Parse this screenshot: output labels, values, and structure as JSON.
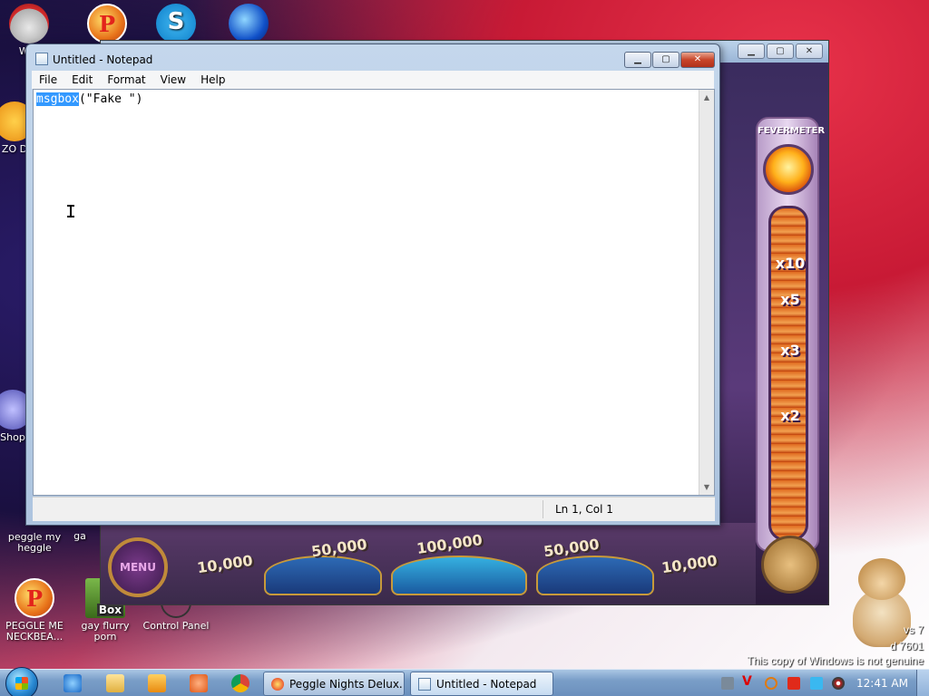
{
  "desktop": {
    "icons": [
      {
        "label": "WIN",
        "icon": "wii-icon"
      },
      {
        "label": "ZO D",
        "icon": "zoom-icon"
      },
      {
        "label": "Shop",
        "icon": "shop-icon"
      },
      {
        "label": "peggle my heggle",
        "icon": "peggle-icon"
      },
      {
        "label": "ga",
        "icon": "game-icon"
      },
      {
        "label": "PEGGLE ME NECKBEA...",
        "icon": "peggle-icon"
      },
      {
        "label": "gay flurry porn",
        "icon": "box-icon"
      },
      {
        "label": "Control Panel",
        "icon": "control-panel-icon"
      }
    ],
    "box_label": "Box",
    "watermark": {
      "line1": "vs 7",
      "line2": "d 7601",
      "line3": "This copy of Windows is not genuine"
    }
  },
  "peggle": {
    "fevermeter_label": "FEVERMETER",
    "multipliers": [
      "x10",
      "x5",
      "x3",
      "x2"
    ],
    "scores": [
      "10,000",
      "50,000",
      "100,000",
      "50,000",
      "10,000"
    ],
    "menu_label": "MENU",
    "controls": {
      "minimize": "▁",
      "maximize": "▢",
      "close": "✕"
    }
  },
  "notepad": {
    "title": "Untitled - Notepad",
    "controls": {
      "minimize": "▁",
      "maximize": "▢",
      "close": "✕"
    },
    "menu": [
      "File",
      "Edit",
      "Format",
      "View",
      "Help"
    ],
    "content_selected": "msgbox",
    "content_rest": "(\"Fake \")",
    "status": "Ln 1, Col 1"
  },
  "taskbar": {
    "quick_launch": [
      "internet-explorer-icon",
      "folder-icon",
      "media-player-icon",
      "paint-icon",
      "chrome-icon"
    ],
    "buttons": [
      {
        "label": "Peggle Nights Delux...",
        "icon": "peggle-icon"
      },
      {
        "label": "Untitled - Notepad",
        "icon": "notepad-icon"
      }
    ],
    "tray": [
      "app-icon",
      "v-icon",
      "search-icon",
      "flag-icon",
      "monitor-icon",
      "volume-icon"
    ],
    "clock": "12:41 AM"
  }
}
